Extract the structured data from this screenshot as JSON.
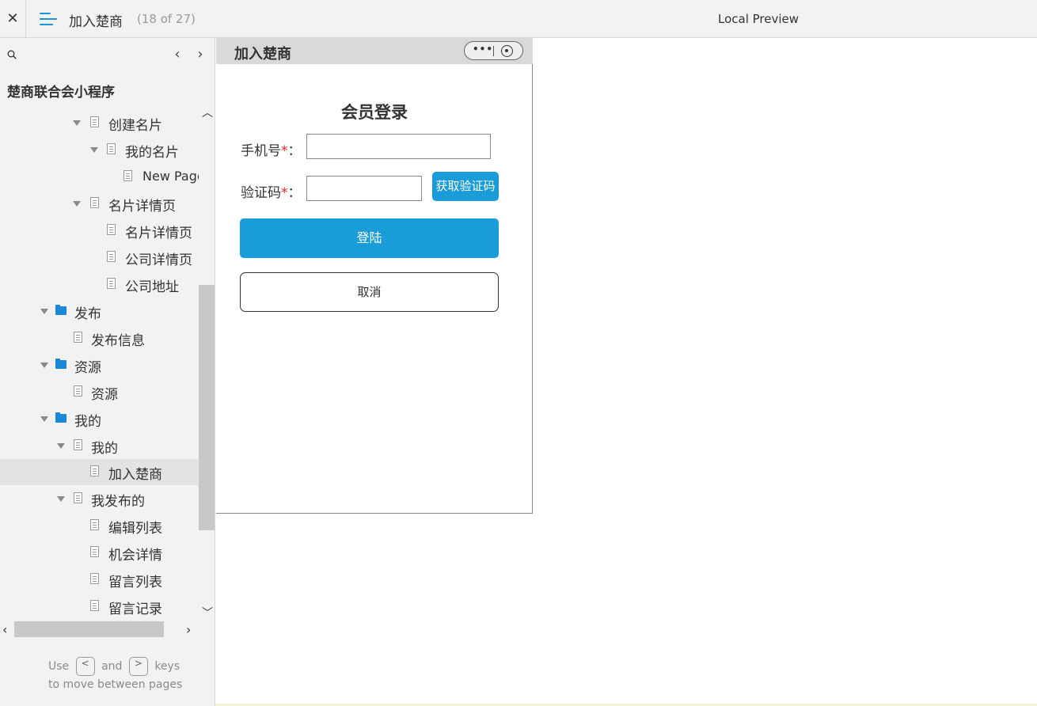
{
  "topbar": {
    "close_glyph": "✕",
    "page_title": "加入楚商",
    "page_count": "(18 of 27)",
    "preview_label": "Local Preview"
  },
  "sidebar": {
    "prev_glyph": "‹",
    "next_glyph": "›",
    "project_name": "楚商联合会小程序",
    "tree": [
      {
        "label": "创建名片",
        "type": "page",
        "expanded": true
      },
      {
        "label": "我的名片",
        "type": "page",
        "expanded": true
      },
      {
        "label": "New Page",
        "type": "page",
        "expanded": false
      },
      {
        "label": "名片详情页",
        "type": "page",
        "expanded": true
      },
      {
        "label": "名片详情页",
        "type": "page",
        "expanded": false
      },
      {
        "label": "公司详情页",
        "type": "page",
        "expanded": false
      },
      {
        "label": "公司地址",
        "type": "page",
        "expanded": false
      },
      {
        "label": "发布",
        "type": "folder",
        "expanded": true
      },
      {
        "label": "发布信息",
        "type": "page",
        "expanded": false
      },
      {
        "label": "资源",
        "type": "folder",
        "expanded": true
      },
      {
        "label": "资源",
        "type": "page",
        "expanded": false
      },
      {
        "label": "我的",
        "type": "folder",
        "expanded": true
      },
      {
        "label": "我的",
        "type": "page",
        "expanded": true
      },
      {
        "label": "加入楚商",
        "type": "page",
        "expanded": false,
        "active": true
      },
      {
        "label": "我发布的",
        "type": "page",
        "expanded": true
      },
      {
        "label": "编辑列表",
        "type": "page",
        "expanded": false
      },
      {
        "label": "机会详情",
        "type": "page",
        "expanded": false
      },
      {
        "label": "留言列表",
        "type": "page",
        "expanded": false
      },
      {
        "label": "留言记录",
        "type": "page",
        "expanded": false
      }
    ],
    "hint": {
      "use": "Use",
      "key_prev": "<",
      "and": "and",
      "key_next": ">",
      "keys": "keys",
      "line2": "to move between pages"
    }
  },
  "phone": {
    "header_title": "加入楚商",
    "capsule_dots": "•••",
    "login_title": "会员登录",
    "phone_label": "手机号",
    "code_label": "验证码",
    "required_mark": "*",
    "colon": "：",
    "phone_value": "",
    "code_value": "",
    "get_code_label": "获取验证码",
    "login_label": "登陆",
    "cancel_label": "取消"
  },
  "colors": {
    "accent": "#1a9cd8",
    "folder": "#1a87d7",
    "required": "#e0242b",
    "sidebar_bg": "#f2f2f2",
    "active_row": "#e3e3e3"
  }
}
